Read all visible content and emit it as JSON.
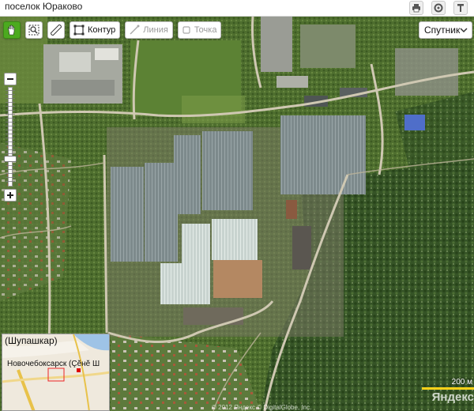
{
  "header": {
    "title": "поселок Юраково",
    "icons": [
      "print-icon",
      "settings-icon",
      "pin-icon"
    ]
  },
  "toolbar": {
    "tools": [
      {
        "name": "hand-tool",
        "icon": "hand-icon",
        "label": "",
        "active": true
      },
      {
        "name": "zoom-area-tool",
        "icon": "zoom-area-icon",
        "label": "",
        "active": false
      },
      {
        "name": "ruler-tool",
        "icon": "ruler-icon",
        "label": "",
        "active": false
      },
      {
        "name": "contour-tool",
        "icon": "contour-icon",
        "label": "Контур",
        "active": false
      },
      {
        "name": "line-tool",
        "icon": "line-icon",
        "label": "Линия",
        "active": false
      },
      {
        "name": "point-tool",
        "icon": "point-icon",
        "label": "Точка",
        "active": false
      }
    ]
  },
  "layer": {
    "selected": "Спутник"
  },
  "zoom": {
    "level_fraction": 0.71
  },
  "overview": {
    "label_top": "(Шупашкар)",
    "label_city": "Новочебоксарск (Çĕнĕ Ш"
  },
  "scale": {
    "label": "200 м"
  },
  "brand": "Яндекс",
  "copyright": "© 2012 Яндекс   © DigitalGlobe, Inc."
}
